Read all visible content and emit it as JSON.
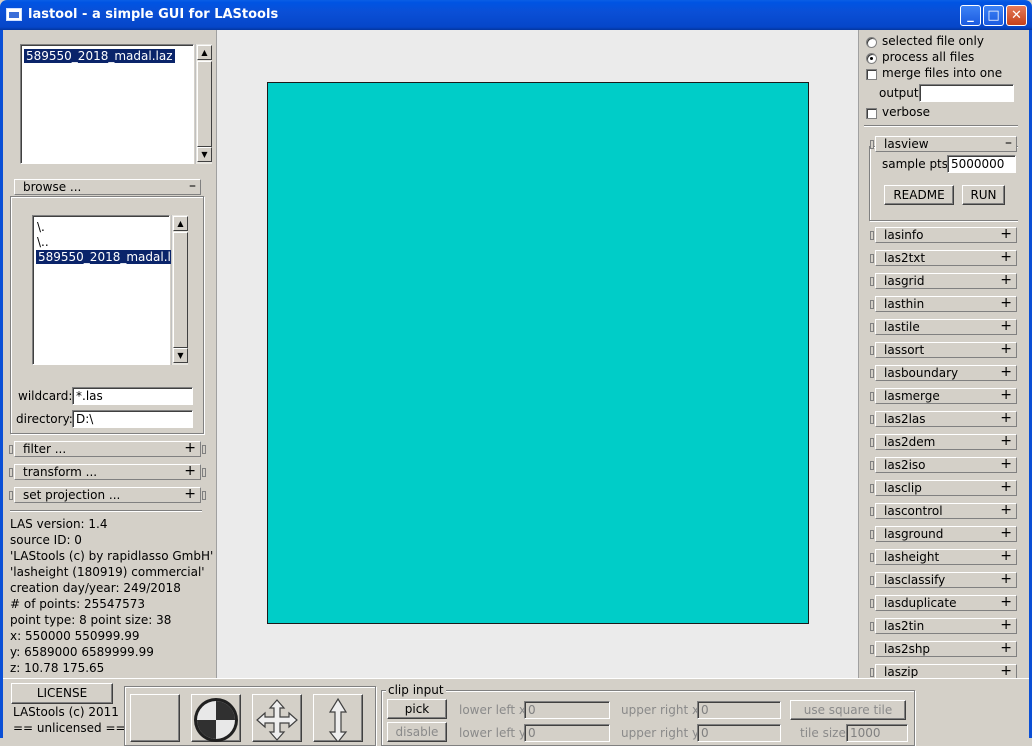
{
  "window": {
    "title": "lastool - a simple GUI for LAStools",
    "minimize_glyph": "_",
    "maximize_glyph": "□",
    "close_glyph": "✕"
  },
  "left": {
    "file_list": [
      "589550_2018_madal.laz"
    ],
    "browse_label": "browse ...",
    "browse_sign": "–",
    "dir_list": [
      "\\.",
      "\\..",
      "589550_2018_madal.l"
    ],
    "wildcard_label": "wildcard:",
    "wildcard_value": "*.las",
    "directory_label": "directory:",
    "directory_value": "D:\\",
    "sections": [
      {
        "label": "filter ...",
        "sign": "+"
      },
      {
        "label": "transform ...",
        "sign": "+"
      },
      {
        "label": "set projection ...",
        "sign": "+"
      }
    ],
    "info": [
      "LAS version: 1.4",
      "source ID: 0",
      "'LAStools (c) by rapidlasso GmbH'",
      "'lasheight (180919) commercial'",
      "creation day/year: 249/2018",
      "# of points: 25547573",
      "point type: 8 point size: 38",
      "x: 550000 550999.99",
      "y: 6589000 6589999.99",
      "z: 10.78 175.65"
    ]
  },
  "canvas": {
    "color": "#00cdc8"
  },
  "right": {
    "options": {
      "selected_only": "selected file only",
      "process_all": "process all files",
      "merge": "merge files into one",
      "output_label": "output:",
      "output_value": "",
      "verbose": "verbose"
    },
    "lasview": {
      "label": "lasview",
      "sign": "–",
      "sample_label": "sample pts:",
      "sample_value": "5000000",
      "readme": "README",
      "run": "RUN"
    },
    "tools": [
      "lasinfo",
      "las2txt",
      "lasgrid",
      "lasthin",
      "lastile",
      "lassort",
      "lasboundary",
      "lasmerge",
      "las2las",
      "las2dem",
      "las2iso",
      "lasclip",
      "lascontrol",
      "lasground",
      "lasheight",
      "lasclassify",
      "lasduplicate",
      "las2tin",
      "las2shp",
      "laszip"
    ],
    "tool_sign": "+"
  },
  "bottom": {
    "license_button": "LICENSE",
    "copyright": "LAStools (c) 2011",
    "license_status": "== unlicensed ==",
    "clip": {
      "title": "clip input",
      "pick": "pick",
      "disable": "disable",
      "lower_left_x_label": "lower left x:",
      "lower_left_x": "0",
      "lower_left_y_label": "lower left y:",
      "lower_left_y": "0",
      "upper_right_x_label": "upper right x:",
      "upper_right_x": "0",
      "upper_right_y_label": "upper right y:",
      "upper_right_y": "0",
      "square_tile": "use square tile",
      "tile_size_label": "tile size:",
      "tile_size": "1000"
    }
  }
}
